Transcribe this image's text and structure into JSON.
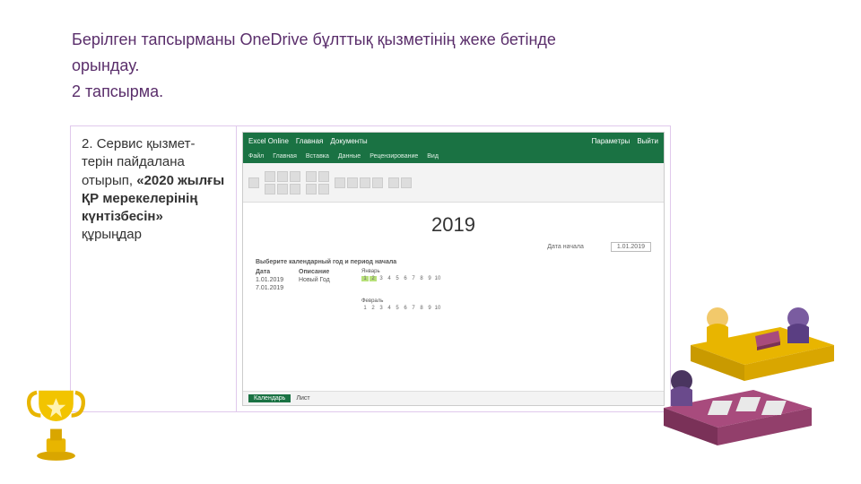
{
  "header": {
    "line1": "Берілген тапсырманы  OneDrive бұлттық қызметінің жеке бетінде",
    "line2": "орындау.",
    "line3": "2 тапсырма."
  },
  "task": {
    "number": "2.",
    "text_pre": "Сервис қызмет-терін пайдалана отырып, ",
    "text_bold": "«2020 жылғы ҚР мерекелерінің күнтізбесін»",
    "text_post": " құрыңдар"
  },
  "excel": {
    "titlebar_left": [
      "Excel Online",
      "Главная",
      "Документы"
    ],
    "titlebar_right": [
      "Параметры",
      "Выйти"
    ],
    "tabs": [
      "Файл",
      "Главная",
      "Вставка",
      "Данные",
      "Рецензирование",
      "Вид"
    ],
    "sheet_title": "2019",
    "meta_label": "Дата начала",
    "meta_date": "1.01.2019",
    "subhead": "Выберите календарный год и период начала",
    "col1_head": "Дата",
    "col2_head": "Описание",
    "rows": [
      {
        "date": "1.01.2019",
        "desc": "Новый Год"
      },
      {
        "date": "7.01.2019",
        "desc": ""
      }
    ],
    "months": [
      "Январь",
      "Февраль"
    ],
    "status_tab": "Календарь",
    "status_tab2": "Лист"
  },
  "icons": {
    "trophy": "trophy-icon",
    "people": "people-illustration"
  }
}
